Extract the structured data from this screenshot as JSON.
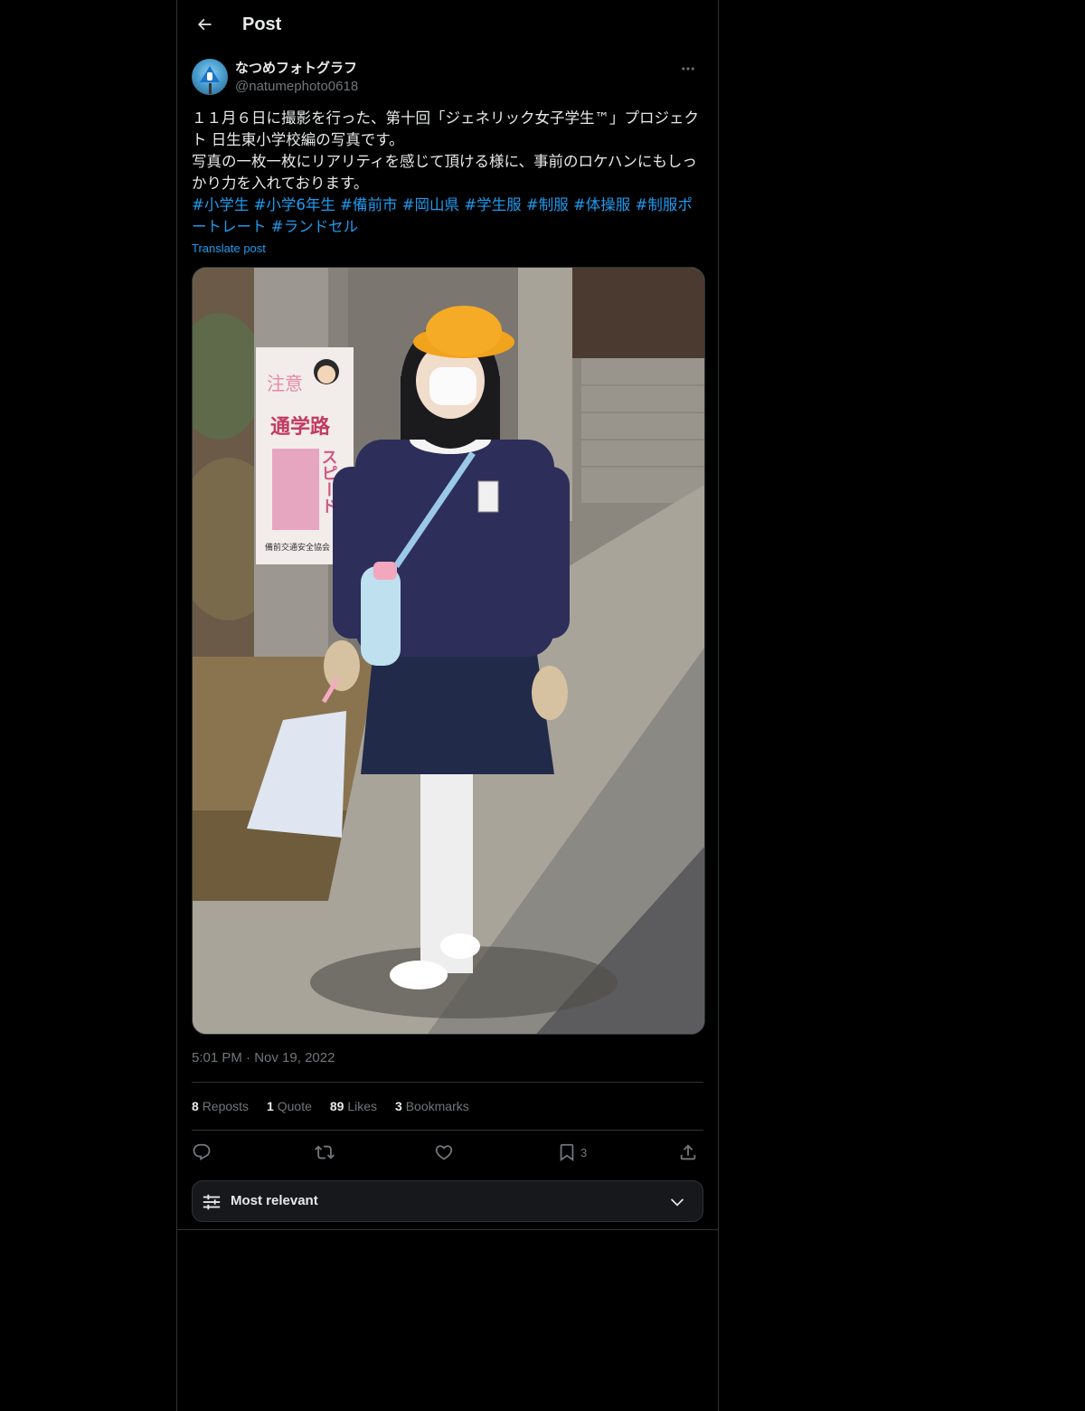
{
  "header": {
    "title": "Post",
    "back_icon": "arrow-left-icon"
  },
  "author": {
    "display_name": "なつめフォトグラフ",
    "handle": "@natumephoto0618",
    "avatar": "avatar-school-crossing-sign"
  },
  "post": {
    "lines": [
      "１１月６日に撮影を行った、第十回「ジェネリック女子学生™」プロジェクト 日生東小学校編の写真です。",
      "写真の一枚一枚にリアリティを感じて頂ける様に、事前のロケハンにもしっかり力を入れております。"
    ],
    "hashtags": [
      "#小学生",
      "#小学6年生",
      "#備前市",
      "#岡山県",
      "#学生服",
      "#制服",
      "#体操服",
      "#制服ポートレート",
      "#ランドセル"
    ],
    "translate_label": "Translate post",
    "photo": {
      "sign_text_top": "注意",
      "sign_text_main": "通学路",
      "sign_text_side": "スピード",
      "sign_footer": "備前交通安全協会　日生支部"
    },
    "time": "5:01 PM",
    "date": "Nov 19, 2022",
    "separator": "·"
  },
  "stats": {
    "reposts_count": "8",
    "reposts_label": "Reposts",
    "quotes_count": "1",
    "quotes_label": "Quote",
    "likes_count": "89",
    "likes_label": "Likes",
    "bookmarks_count": "3",
    "bookmarks_label": "Bookmarks"
  },
  "actions": {
    "reply_icon": "reply-icon",
    "repost_icon": "repost-icon",
    "like_icon": "heart-icon",
    "bookmark_icon": "bookmark-icon",
    "bookmark_count": "3",
    "share_icon": "share-icon"
  },
  "sort": {
    "label": "Most relevant"
  },
  "colors": {
    "background": "#000000",
    "text": "#e7e9ea",
    "muted": "#71767b",
    "accent": "#1d9bf0",
    "border": "#2f3336"
  }
}
